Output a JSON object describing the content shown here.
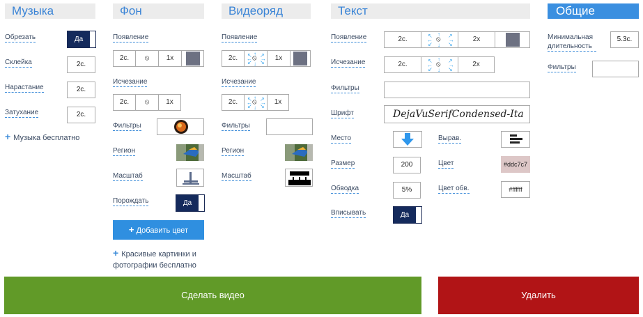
{
  "sections": {
    "music": "Музыка",
    "background": "Фон",
    "video": "Видеоряд",
    "text": "Текст",
    "general": "Общие"
  },
  "music": {
    "trim_label": "Обрезать",
    "trim_value": "Да",
    "crossfade_label": "Склейка",
    "crossfade_value": "2с.",
    "fadein_label": "Нарастание",
    "fadein_value": "2с.",
    "fadeout_label": "Затухание",
    "fadeout_value": "2с.",
    "free_music_link": "Музыка бесплатно"
  },
  "background": {
    "appear_label": "Появление",
    "appear": [
      "2с.",
      "⦸",
      "1x"
    ],
    "disappear_label": "Исчезание",
    "disappear": [
      "2с.",
      "⦸",
      "1x"
    ],
    "filters_label": "Фильтры",
    "region_label": "Регион",
    "scale_label": "Масштаб",
    "spawn_label": "Порождать",
    "spawn_value": "Да",
    "add_color_button": "Добавить цвет",
    "free_pictures_link": "Красивые картинки и фотографии бесплатно"
  },
  "video": {
    "appear_label": "Появление",
    "appear": [
      "2с.",
      "⦸",
      "1x"
    ],
    "disappear_label": "Исчезание",
    "disappear": [
      "2с.",
      "⦸",
      "1x"
    ],
    "filters_label": "Фильтры",
    "region_label": "Регион",
    "scale_label": "Масштаб"
  },
  "text": {
    "appear_label": "Появление",
    "appear": [
      "2с.",
      "⦸",
      "2x"
    ],
    "disappear_label": "Исчезание",
    "disappear": [
      "2с.",
      "⦸",
      "2x"
    ],
    "filters_label": "Фильтры",
    "font_label": "Шрифт",
    "font_value": "DejaVuSerifCondensed-Ita",
    "place_label": "Место",
    "align_label": "Вырав.",
    "size_label": "Размер",
    "size_value": "200",
    "color_label": "Цвет",
    "color_value": "#ddc7c7",
    "outline_label": "Обводка",
    "outline_value": "5%",
    "outline_color_label": "Цвет обв.",
    "outline_color_value": "#ffffff",
    "fit_label": "Вписывать",
    "fit_value": "Да"
  },
  "general": {
    "min_duration_label": "Минимальная длительность",
    "min_duration_value": "5.3с.",
    "filters_label": "Фильтры"
  },
  "actions": {
    "make_video": "Сделать видео",
    "delete": "Удалить"
  },
  "colors": {
    "accent": "#3a8fe0",
    "toggle_on": "#142a5c",
    "make_video_bg": "#619a28",
    "delete_bg": "#b11416",
    "text_color_swatch": "#ddc7c7"
  }
}
